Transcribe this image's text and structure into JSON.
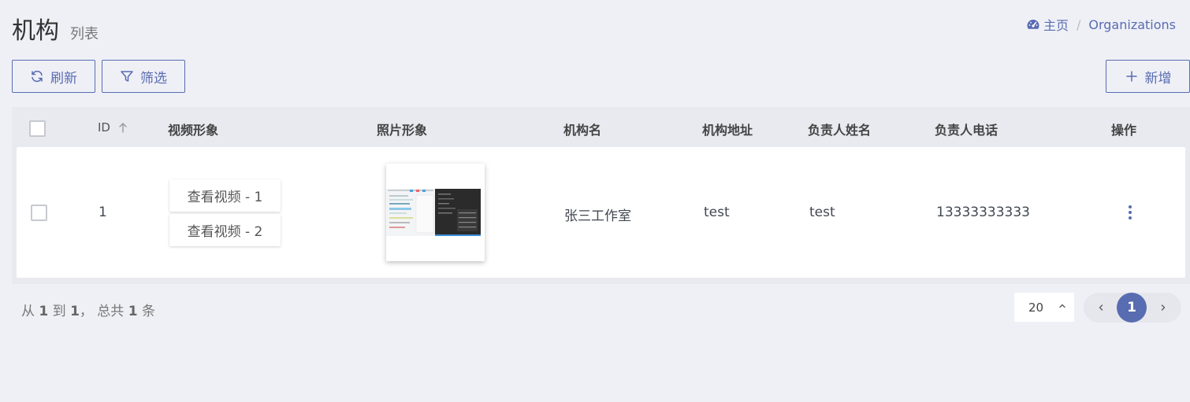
{
  "header": {
    "title": "机构",
    "subtitle": "列表"
  },
  "breadcrumb": {
    "home": "主页",
    "separator": "/",
    "current": "Organizations",
    "home_icon": "tachometer-icon"
  },
  "toolbar": {
    "refresh_label": "刷新",
    "filter_label": "筛选",
    "add_label": "新增"
  },
  "table": {
    "columns": {
      "id": "ID",
      "video": "视频形象",
      "photo": "照片形象",
      "name": "机构名",
      "address": "机构地址",
      "contact_name": "负责人姓名",
      "contact_phone": "负责人电话",
      "actions": "操作"
    },
    "rows": [
      {
        "id": "1",
        "videos": [
          "查看视频 - 1",
          "查看视频 - 2"
        ],
        "name": "张三工作室",
        "address": "test",
        "contact_name": "test",
        "contact_phone": "13333333333"
      }
    ]
  },
  "footer": {
    "summary_from_label": "从",
    "from": "1",
    "summary_to_label": "到",
    "to": "1",
    "summary_total_label": "， 总共",
    "total": "1",
    "summary_unit": "条",
    "per_page": "20",
    "current_page": "1"
  },
  "colors": {
    "accent": "#586cb1",
    "background": "#eff0f6"
  }
}
